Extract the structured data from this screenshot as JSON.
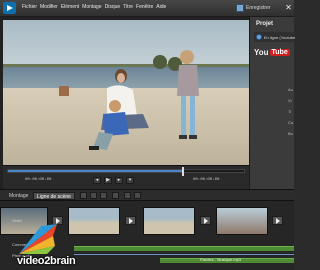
{
  "menubar": {
    "menu_items": [
      "Fichier",
      "Modifier",
      "Elément",
      "Montage",
      "Disque",
      "Titre",
      "Fenêtre",
      "Aide"
    ],
    "save_label": "Enregistrer"
  },
  "monitor": {
    "time_current": "00:00:00:00",
    "time_total": "00:00:00:00",
    "playhead_progress": 0.74
  },
  "right_panel": {
    "title": "Projet",
    "online_label": "En ligne (Youtube)",
    "youtube_you": "You",
    "youtube_tube": "Tube",
    "lines": [
      "Au",
      "Vi",
      "Ti",
      "Ca",
      "Bu"
    ]
  },
  "timeline": {
    "tabs": [
      "Montage",
      "Ligne de scène"
    ],
    "active_tab": "Ligne de scène",
    "track_labels": [
      "Vidéo",
      "Commentaires",
      "Piste audio"
    ],
    "audio_clip_label": "Paroles - Musique.mp3"
  },
  "watermark": "video2brain",
  "colors": {
    "accent": "#4a85c8",
    "audio": "#4e8c33",
    "youtube_red": "#cc1f1f"
  }
}
